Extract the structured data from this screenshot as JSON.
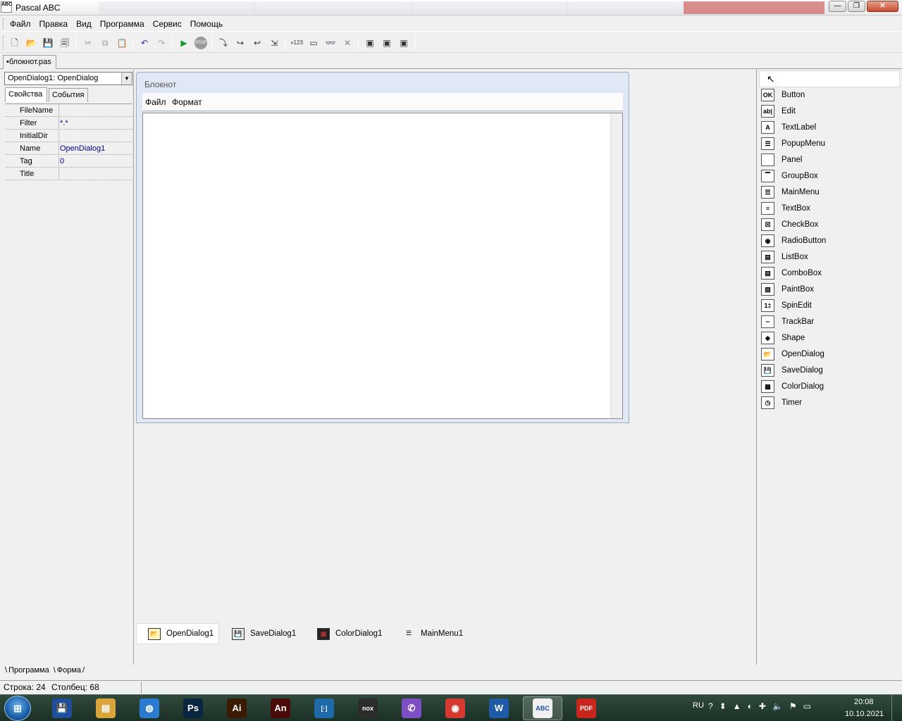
{
  "window": {
    "title": "Pascal ABC",
    "app_icon_text": "ABC",
    "minimize": "—",
    "maximize": "❐",
    "close": "✕"
  },
  "menu": [
    "Файл",
    "Правка",
    "Вид",
    "Программа",
    "Сервис",
    "Помощь"
  ],
  "toolbar": {
    "buttons": [
      "new-file",
      "open-file",
      "save-file",
      "save-all",
      "cut",
      "copy",
      "paste",
      "undo",
      "redo",
      "run",
      "stop",
      "step-into",
      "step-over",
      "step-out",
      "run-to-cursor",
      "show-value",
      "window",
      "watch",
      "close-watch",
      "form-a",
      "form-b",
      "form-c"
    ],
    "value_label": "»123",
    "stop_label": "STOP"
  },
  "file_tab": "•блокнот.pas",
  "inspector": {
    "object": "OpenDialog1: OpenDialog",
    "tabs": [
      "Свойства",
      "События"
    ],
    "properties": [
      {
        "name": "FileName",
        "value": ""
      },
      {
        "name": "Filter",
        "value": "*.*"
      },
      {
        "name": "InitialDir",
        "value": ""
      },
      {
        "name": "Name",
        "value": "OpenDialog1"
      },
      {
        "name": "Tag",
        "value": "0"
      },
      {
        "name": "Title",
        "value": ""
      }
    ],
    "bottom_tabs": [
      "Программа",
      "Форма"
    ]
  },
  "form": {
    "title": "Блокнот",
    "menu": [
      "Файл",
      "Формат"
    ]
  },
  "nonvisual": [
    {
      "label": "OpenDialog1",
      "icon": "open-dialog-icon",
      "glyph": "📂",
      "selected": true
    },
    {
      "label": "SaveDialog1",
      "icon": "save-dialog-icon",
      "glyph": "💾",
      "selected": false
    },
    {
      "label": "ColorDialog1",
      "icon": "color-dialog-icon",
      "glyph": "▦",
      "selected": false
    },
    {
      "label": "MainMenu1",
      "icon": "main-menu-icon",
      "glyph": "☰",
      "selected": false
    }
  ],
  "palette": {
    "pointer": "↖",
    "items": [
      {
        "label": "Button",
        "icon": "button-icon",
        "glyph": "OK"
      },
      {
        "label": "Edit",
        "icon": "edit-icon",
        "glyph": "ab|"
      },
      {
        "label": "TextLabel",
        "icon": "text-label-icon",
        "glyph": "A"
      },
      {
        "label": "PopupMenu",
        "icon": "popup-menu-icon",
        "glyph": "☰"
      },
      {
        "label": "Panel",
        "icon": "panel-icon",
        "glyph": ""
      },
      {
        "label": "GroupBox",
        "icon": "group-box-icon",
        "glyph": "▔"
      },
      {
        "label": "MainMenu",
        "icon": "main-menu-icon",
        "glyph": "☰"
      },
      {
        "label": "TextBox",
        "icon": "text-box-icon",
        "glyph": "≡"
      },
      {
        "label": "CheckBox",
        "icon": "check-box-icon",
        "glyph": "☒"
      },
      {
        "label": "RadioButton",
        "icon": "radio-button-icon",
        "glyph": "◉"
      },
      {
        "label": "ListBox",
        "icon": "list-box-icon",
        "glyph": "▤"
      },
      {
        "label": "ComboBox",
        "icon": "combo-box-icon",
        "glyph": "▤"
      },
      {
        "label": "PaintBox",
        "icon": "paint-box-icon",
        "glyph": "▨"
      },
      {
        "label": "SpinEdit",
        "icon": "spin-edit-icon",
        "glyph": "1‡"
      },
      {
        "label": "TrackBar",
        "icon": "track-bar-icon",
        "glyph": "┄"
      },
      {
        "label": "Shape",
        "icon": "shape-icon",
        "glyph": "◆"
      },
      {
        "label": "OpenDialog",
        "icon": "open-dialog-icon",
        "glyph": "📂"
      },
      {
        "label": "SaveDialog",
        "icon": "save-dialog-icon",
        "glyph": "💾"
      },
      {
        "label": "ColorDialog",
        "icon": "color-dialog-icon",
        "glyph": "▦"
      },
      {
        "label": "Timer",
        "icon": "timer-icon",
        "glyph": "◷"
      }
    ]
  },
  "status": {
    "line": "Строка: 24",
    "column": "Столбец: 68"
  },
  "taskbar": {
    "apps": [
      {
        "name": "save-app-icon",
        "glyph": "💾",
        "color": "#1f4f9a"
      },
      {
        "name": "explorer-icon",
        "glyph": "▤",
        "color": "#d9a53a"
      },
      {
        "name": "globe-icon",
        "glyph": "◍",
        "color": "#2a7bd0"
      },
      {
        "name": "photoshop-icon",
        "glyph": "Ps",
        "color": "#0a2540"
      },
      {
        "name": "illustrator-icon",
        "glyph": "Ai",
        "color": "#3a1a00"
      },
      {
        "name": "animate-icon",
        "glyph": "An",
        "color": "#4a0a0a"
      },
      {
        "name": "bracket-app-icon",
        "glyph": "[·]",
        "color": "#1e6aa8"
      },
      {
        "name": "nox-icon",
        "glyph": "nox",
        "color": "#2c2c2c"
      },
      {
        "name": "viber-icon",
        "glyph": "✆",
        "color": "#7d4fc3"
      },
      {
        "name": "chrome-icon",
        "glyph": "◉",
        "color": "#d5392f"
      },
      {
        "name": "word-icon",
        "glyph": "W",
        "color": "#1f5aa8"
      },
      {
        "name": "pascal-abc-icon",
        "glyph": "ABC",
        "color": "#f0f0f0"
      },
      {
        "name": "pdf-icon",
        "glyph": "PDF",
        "color": "#c8261c"
      }
    ],
    "active_app_index": 11,
    "lang": "RU",
    "tray_glyphs": [
      "?",
      "⬍",
      "▲",
      "◐",
      "✚",
      "🔈",
      "⚑",
      "▭"
    ],
    "time": "20:08",
    "date": "10.10.2021"
  }
}
